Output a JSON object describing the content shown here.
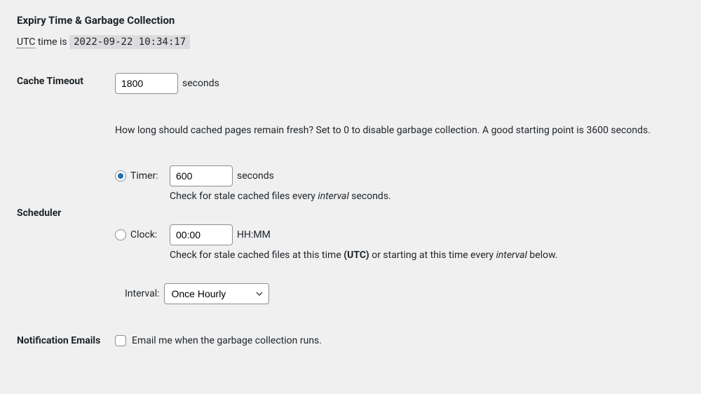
{
  "section_title": "Expiry Time & Garbage Collection",
  "utc": {
    "label": "UTC",
    "time_is": " time is ",
    "timestamp": "2022-09-22 10:34:17"
  },
  "cache_timeout": {
    "label": "Cache Timeout",
    "value": "1800",
    "unit": "seconds",
    "description": "How long should cached pages remain fresh? Set to 0 to disable garbage collection. A good starting point is 3600 seconds."
  },
  "scheduler": {
    "label": "Scheduler",
    "timer": {
      "radio_label": "Timer:",
      "value": "600",
      "unit": "seconds",
      "hint_before": "Check for stale cached files every ",
      "hint_em": "interval",
      "hint_after": " seconds."
    },
    "clock": {
      "radio_label": "Clock:",
      "value": "00:00",
      "unit": "HH:MM",
      "hint_before": "Check for stale cached files at this time ",
      "hint_bold": "(UTC)",
      "hint_mid": " or starting at this time every ",
      "hint_em": "interval",
      "hint_after": " below."
    },
    "interval": {
      "label": "Interval:",
      "selected": "Once Hourly"
    }
  },
  "notification": {
    "label": "Notification Emails",
    "checkbox_label": "Email me when the garbage collection runs."
  }
}
